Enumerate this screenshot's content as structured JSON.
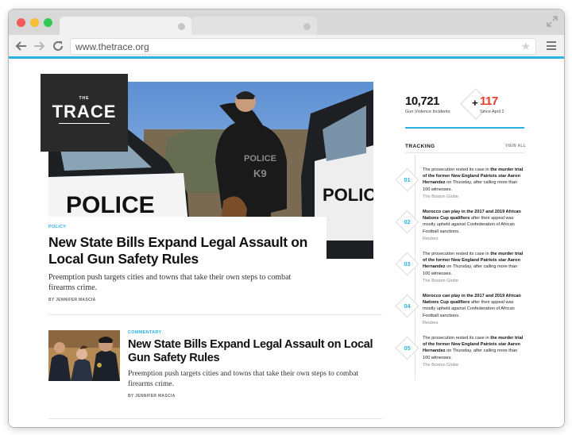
{
  "browser": {
    "url": "www.thetrace.org",
    "accent_color": "#2bb2e4"
  },
  "logo": {
    "small": "THE",
    "name": "TRACE"
  },
  "hero": {
    "tag": "POLICY",
    "title": "New State Bills Expand Legal Assault on Local Gun Safety Rules",
    "dek": "Preemption push targets cities and towns that take their own steps to combat firearms crime.",
    "byline": "BY JENNIFER MASCIA"
  },
  "story2": {
    "tag": "COMMENTARY",
    "title": "New State Bills Expand Legal Assault on Local Gun Safety Rules",
    "dek": "Preemption push targets cities and towns that take their own steps to combat firearms crime.",
    "byline": "BY JENNIFER MASCIA"
  },
  "stats": {
    "count": "10,721",
    "count_label": "Gun Violence Incidents",
    "plus": "+",
    "delta": "117",
    "delta_label": "Since April 2",
    "delta_color": "#e53e2d"
  },
  "tracking": {
    "title": "TRACKING",
    "view_all": "VIEW ALL",
    "items": [
      {
        "num": "01",
        "pre": "The prosecution rested its case in ",
        "bold": "the murder trial of the former New England Patriots star Aaron Hernandez",
        "post": " on Thursday, after calling more than 100 witnesses.",
        "source": "The Boston Globe"
      },
      {
        "num": "02",
        "pre": "",
        "bold": "Morocco can play in the 2017 and 2019 African Nations Cup qualifiers",
        "post": " after their appeal was mostly upheld against Confederation of African Football sanctions.",
        "source": "Reuters"
      },
      {
        "num": "03",
        "pre": "The prosecution rested its case in ",
        "bold": "the murder trial of the former New England Patriots star Aaron Hernandez",
        "post": " on Thursday, after calling more than 100 witnesses.",
        "source": "The Boston Globe"
      },
      {
        "num": "04",
        "pre": "",
        "bold": "Morocco can play in the 2017 and 2019 African Nations Cup qualifiers",
        "post": " after their appeal was mostly upheld against Confederation of African Football sanctions.",
        "source": "Reuters"
      },
      {
        "num": "05",
        "pre": "The prosecution rested its case in ",
        "bold": "the murder trial of the former New England Patriots star Aaron Hernandez",
        "post": " on Thursday, after calling more than 100 witnesses.",
        "source": "The Boston Globe"
      }
    ]
  }
}
